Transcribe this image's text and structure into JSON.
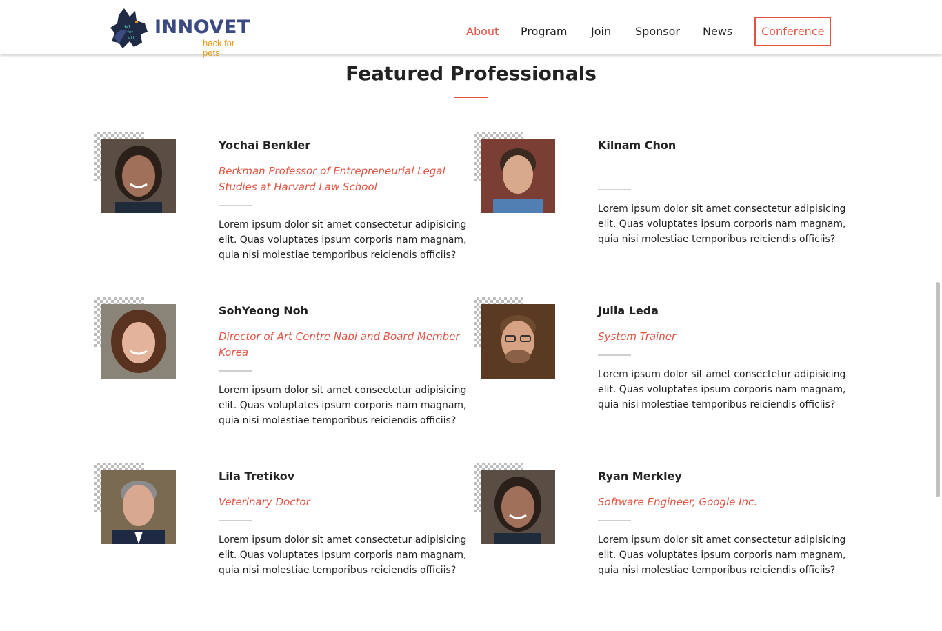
{
  "header": {
    "logo_title": "INNOVET",
    "logo_subtitle": "hack for pets",
    "nav": [
      {
        "label": "About",
        "active": true
      },
      {
        "label": "Program",
        "active": false
      },
      {
        "label": "Join",
        "active": false
      },
      {
        "label": "Sponsor",
        "active": false
      },
      {
        "label": "News",
        "active": false
      }
    ],
    "cta_label": "Conference"
  },
  "section": {
    "title": "Featured Professionals"
  },
  "colors": {
    "accent": "#e25441",
    "logo_blue": "#3c4a82",
    "logo_orange": "#e49a1c",
    "text": "#222222"
  },
  "professionals": [
    {
      "name": "Yochai Benkler",
      "role": "Berkman Professor of Entrepreneurial Legal Studies at Harvard Law School",
      "bio": "Lorem ipsum dolor sit amet consectetur adipisicing elit. Quas voluptates ipsum corporis nam magnam, quia nisi molestiae temporibus reiciendis officiis?"
    },
    {
      "name": "Kilnam Chon",
      "role": "",
      "bio": "Lorem ipsum dolor sit amet consectetur adipisicing elit. Quas voluptates ipsum corporis nam magnam, quia nisi molestiae temporibus reiciendis officiis?"
    },
    {
      "name": "SohYeong Noh",
      "role": "Director of Art Centre Nabi and Board Member Korea",
      "bio": "Lorem ipsum dolor sit amet consectetur adipisicing elit. Quas voluptates ipsum corporis nam magnam, quia nisi molestiae temporibus reiciendis officiis?"
    },
    {
      "name": "Julia Leda",
      "role": "System Trainer",
      "bio": "Lorem ipsum dolor sit amet consectetur adipisicing elit. Quas voluptates ipsum corporis nam magnam, quia nisi molestiae temporibus reiciendis officiis?"
    },
    {
      "name": "Lila Tretikov",
      "role": "Veterinary Doctor",
      "bio": "Lorem ipsum dolor sit amet consectetur adipisicing elit. Quas voluptates ipsum corporis nam magnam, quia nisi molestiae temporibus reiciendis officiis?"
    },
    {
      "name": "Ryan Merkley",
      "role": "Software Engineer, Google Inc.",
      "bio": "Lorem ipsum dolor sit amet consectetur adipisicing elit. Quas voluptates ipsum corporis nam magnam, quia nisi molestiae temporibus reiciendis officiis?"
    }
  ]
}
